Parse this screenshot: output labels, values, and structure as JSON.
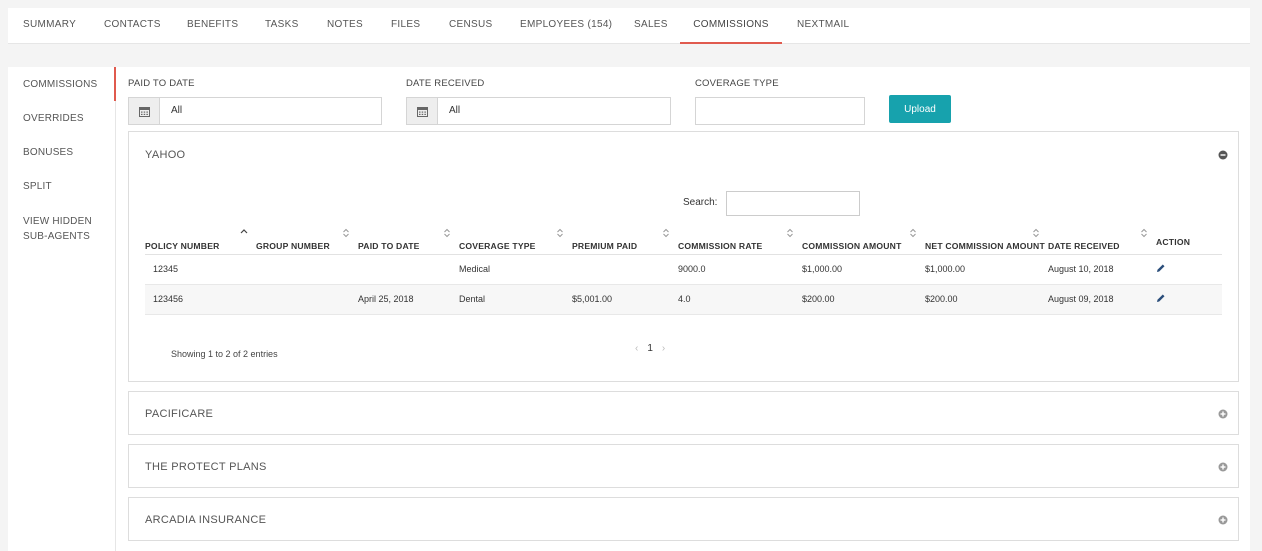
{
  "tabs": [
    {
      "label": "SUMMARY"
    },
    {
      "label": "CONTACTS"
    },
    {
      "label": "BENEFITS"
    },
    {
      "label": "TASKS"
    },
    {
      "label": "NOTES"
    },
    {
      "label": "FILES"
    },
    {
      "label": "CENSUS"
    },
    {
      "label": "EMPLOYEES (154)"
    },
    {
      "label": "SALES"
    },
    {
      "label": "COMMISSIONS"
    },
    {
      "label": "NEXTMAIL"
    }
  ],
  "sidebar": {
    "items": [
      {
        "label": "COMMISSIONS"
      },
      {
        "label": "OVERRIDES"
      },
      {
        "label": "BONUSES"
      },
      {
        "label": "SPLIT"
      },
      {
        "label": "VIEW HIDDEN SUB-AGENTS"
      }
    ]
  },
  "filters": {
    "paid_to_date": {
      "label": "PAID TO DATE",
      "value": "All"
    },
    "date_received": {
      "label": "DATE RECEIVED",
      "value": "All"
    },
    "coverage_type": {
      "label": "COVERAGE TYPE",
      "value": ""
    },
    "upload_label": "Upload"
  },
  "panels": [
    {
      "title": "YAHOO",
      "search_label": "Search:",
      "columns": [
        "POLICY NUMBER",
        "GROUP NUMBER",
        "PAID TO DATE",
        "COVERAGE TYPE",
        "PREMIUM PAID",
        "COMMISSION RATE",
        "COMMISSION AMOUNT",
        "NET COMMISSION AMOUNT",
        "DATE RECEIVED",
        "ACTION"
      ],
      "rows": [
        [
          "12345",
          "",
          "",
          "Medical",
          "",
          "9000.0",
          "$1,000.00",
          "$1,000.00",
          "August 10, 2018"
        ],
        [
          "123456",
          "",
          "April 25, 2018",
          "Dental",
          "$5,001.00",
          "4.0",
          "$200.00",
          "$200.00",
          "August 09, 2018"
        ]
      ],
      "info": "Showing 1 to 2 of 2 entries",
      "page": "1"
    },
    {
      "title": "PACIFICARE"
    },
    {
      "title": "THE PROTECT PLANS"
    },
    {
      "title": "ARCADIA INSURANCE"
    }
  ],
  "colors": {
    "accent": "#e05a4e",
    "button": "#17a2ad"
  }
}
